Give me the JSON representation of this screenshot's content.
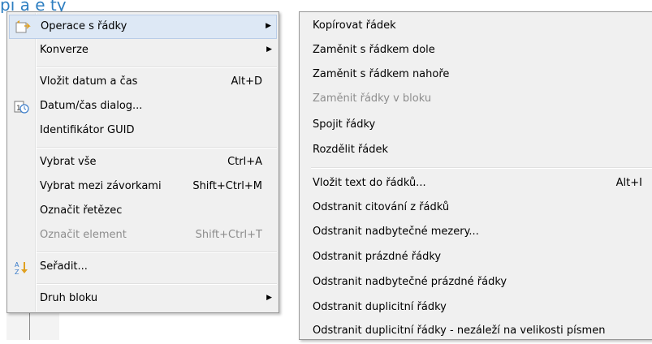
{
  "header": {
    "partial_title": "pi a e ty"
  },
  "main_menu": {
    "items": [
      {
        "label": "Operace s řádky",
        "shortcut": "",
        "submenu": true,
        "disabled": false,
        "highlighted": true,
        "icon": "row-operations-icon"
      },
      {
        "label": "Konverze",
        "shortcut": "",
        "submenu": true,
        "disabled": false,
        "highlighted": false,
        "icon": ""
      },
      {
        "label": "Vložit datum a čas",
        "shortcut": "Alt+D",
        "submenu": false,
        "disabled": false,
        "highlighted": false,
        "icon": ""
      },
      {
        "label": "Datum/čas dialog...",
        "shortcut": "",
        "submenu": false,
        "disabled": false,
        "highlighted": false,
        "icon": "calendar-clock-icon"
      },
      {
        "label": "Identifikátor GUID",
        "shortcut": "",
        "submenu": false,
        "disabled": false,
        "highlighted": false,
        "icon": ""
      },
      {
        "label": "Vybrat vše",
        "shortcut": "Ctrl+A",
        "submenu": false,
        "disabled": false,
        "highlighted": false,
        "icon": ""
      },
      {
        "label": "Vybrat mezi závorkami",
        "shortcut": "Shift+Ctrl+M",
        "submenu": false,
        "disabled": false,
        "highlighted": false,
        "icon": ""
      },
      {
        "label": "Označit řetězec",
        "shortcut": "",
        "submenu": false,
        "disabled": false,
        "highlighted": false,
        "icon": ""
      },
      {
        "label": "Označit element",
        "shortcut": "Shift+Ctrl+T",
        "submenu": false,
        "disabled": true,
        "highlighted": false,
        "icon": ""
      },
      {
        "label": "Seřadit...",
        "shortcut": "",
        "submenu": false,
        "disabled": false,
        "highlighted": false,
        "icon": "sort-az-icon"
      },
      {
        "label": "Druh bloku",
        "shortcut": "",
        "submenu": true,
        "disabled": false,
        "highlighted": false,
        "icon": ""
      }
    ]
  },
  "sub_menu": {
    "items": [
      {
        "label": "Kopírovat řádek",
        "shortcut": "",
        "disabled": false
      },
      {
        "label": "Zaměnit s řádkem dole",
        "shortcut": "",
        "disabled": false
      },
      {
        "label": "Zaměnit s řádkem nahoře",
        "shortcut": "",
        "disabled": false
      },
      {
        "label": "Zaměnit řádky v bloku",
        "shortcut": "",
        "disabled": true
      },
      {
        "label": "Spojit řádky",
        "shortcut": "",
        "disabled": false
      },
      {
        "label": "Rozdělit řádek",
        "shortcut": "",
        "disabled": false
      },
      {
        "label": "Vložit text do řádků...",
        "shortcut": "Alt+I",
        "disabled": false
      },
      {
        "label": "Odstranit citování z řádků",
        "shortcut": "",
        "disabled": false
      },
      {
        "label": "Odstranit nadbytečné mezery...",
        "shortcut": "",
        "disabled": false
      },
      {
        "label": "Odstranit prázdné řádky",
        "shortcut": "",
        "disabled": false
      },
      {
        "label": "Odstranit nadbytečné prázdné řádky",
        "shortcut": "",
        "disabled": false
      },
      {
        "label": "Odstranit duplicitní řádky",
        "shortcut": "",
        "disabled": false
      },
      {
        "label": "Odstranit duplicitní řádky - nezáleží na velikosti písmen",
        "shortcut": "",
        "disabled": false
      }
    ]
  },
  "colors": {
    "accent_title": "#2f7fc1",
    "highlight": "#dde8f5",
    "disabled_text": "#8d8d8d"
  }
}
